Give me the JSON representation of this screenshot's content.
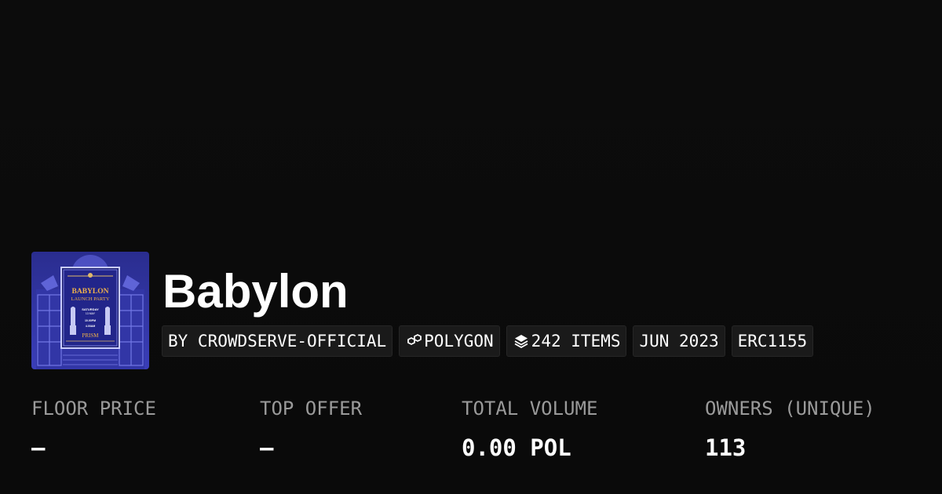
{
  "collection": {
    "name": "Babylon",
    "image_alt": "Babylon Launch Party poster",
    "poster": {
      "title_line1": "BABYLON",
      "title_line2": "LAUNCH PARTY",
      "day": "SATURDAY",
      "date": "13 MAY",
      "time_start": "10.00PM",
      "time_end": "4.00AM",
      "venue": "PRISM"
    }
  },
  "tags": {
    "creator": "BY CROWDSERVE-OFFICIAL",
    "chain": "POLYGON",
    "chain_icon": "polygon-chain-icon",
    "items": "242 ITEMS",
    "items_icon": "layers-icon",
    "date": "JUN 2023",
    "standard": "ERC1155"
  },
  "stats": {
    "floor_price": {
      "label": "FLOOR PRICE",
      "value": "–"
    },
    "top_offer": {
      "label": "TOP OFFER",
      "value": "–"
    },
    "total_volume": {
      "label": "TOTAL VOLUME",
      "value": "0.00 POL"
    },
    "owners": {
      "label": "OWNERS (UNIQUE)",
      "value": "113"
    }
  },
  "colors": {
    "background": "#0b0b0b",
    "tag_background": "#1a1a1a",
    "label_gray": "#9a9a9a",
    "poster_blue": "#3b3fb5"
  }
}
